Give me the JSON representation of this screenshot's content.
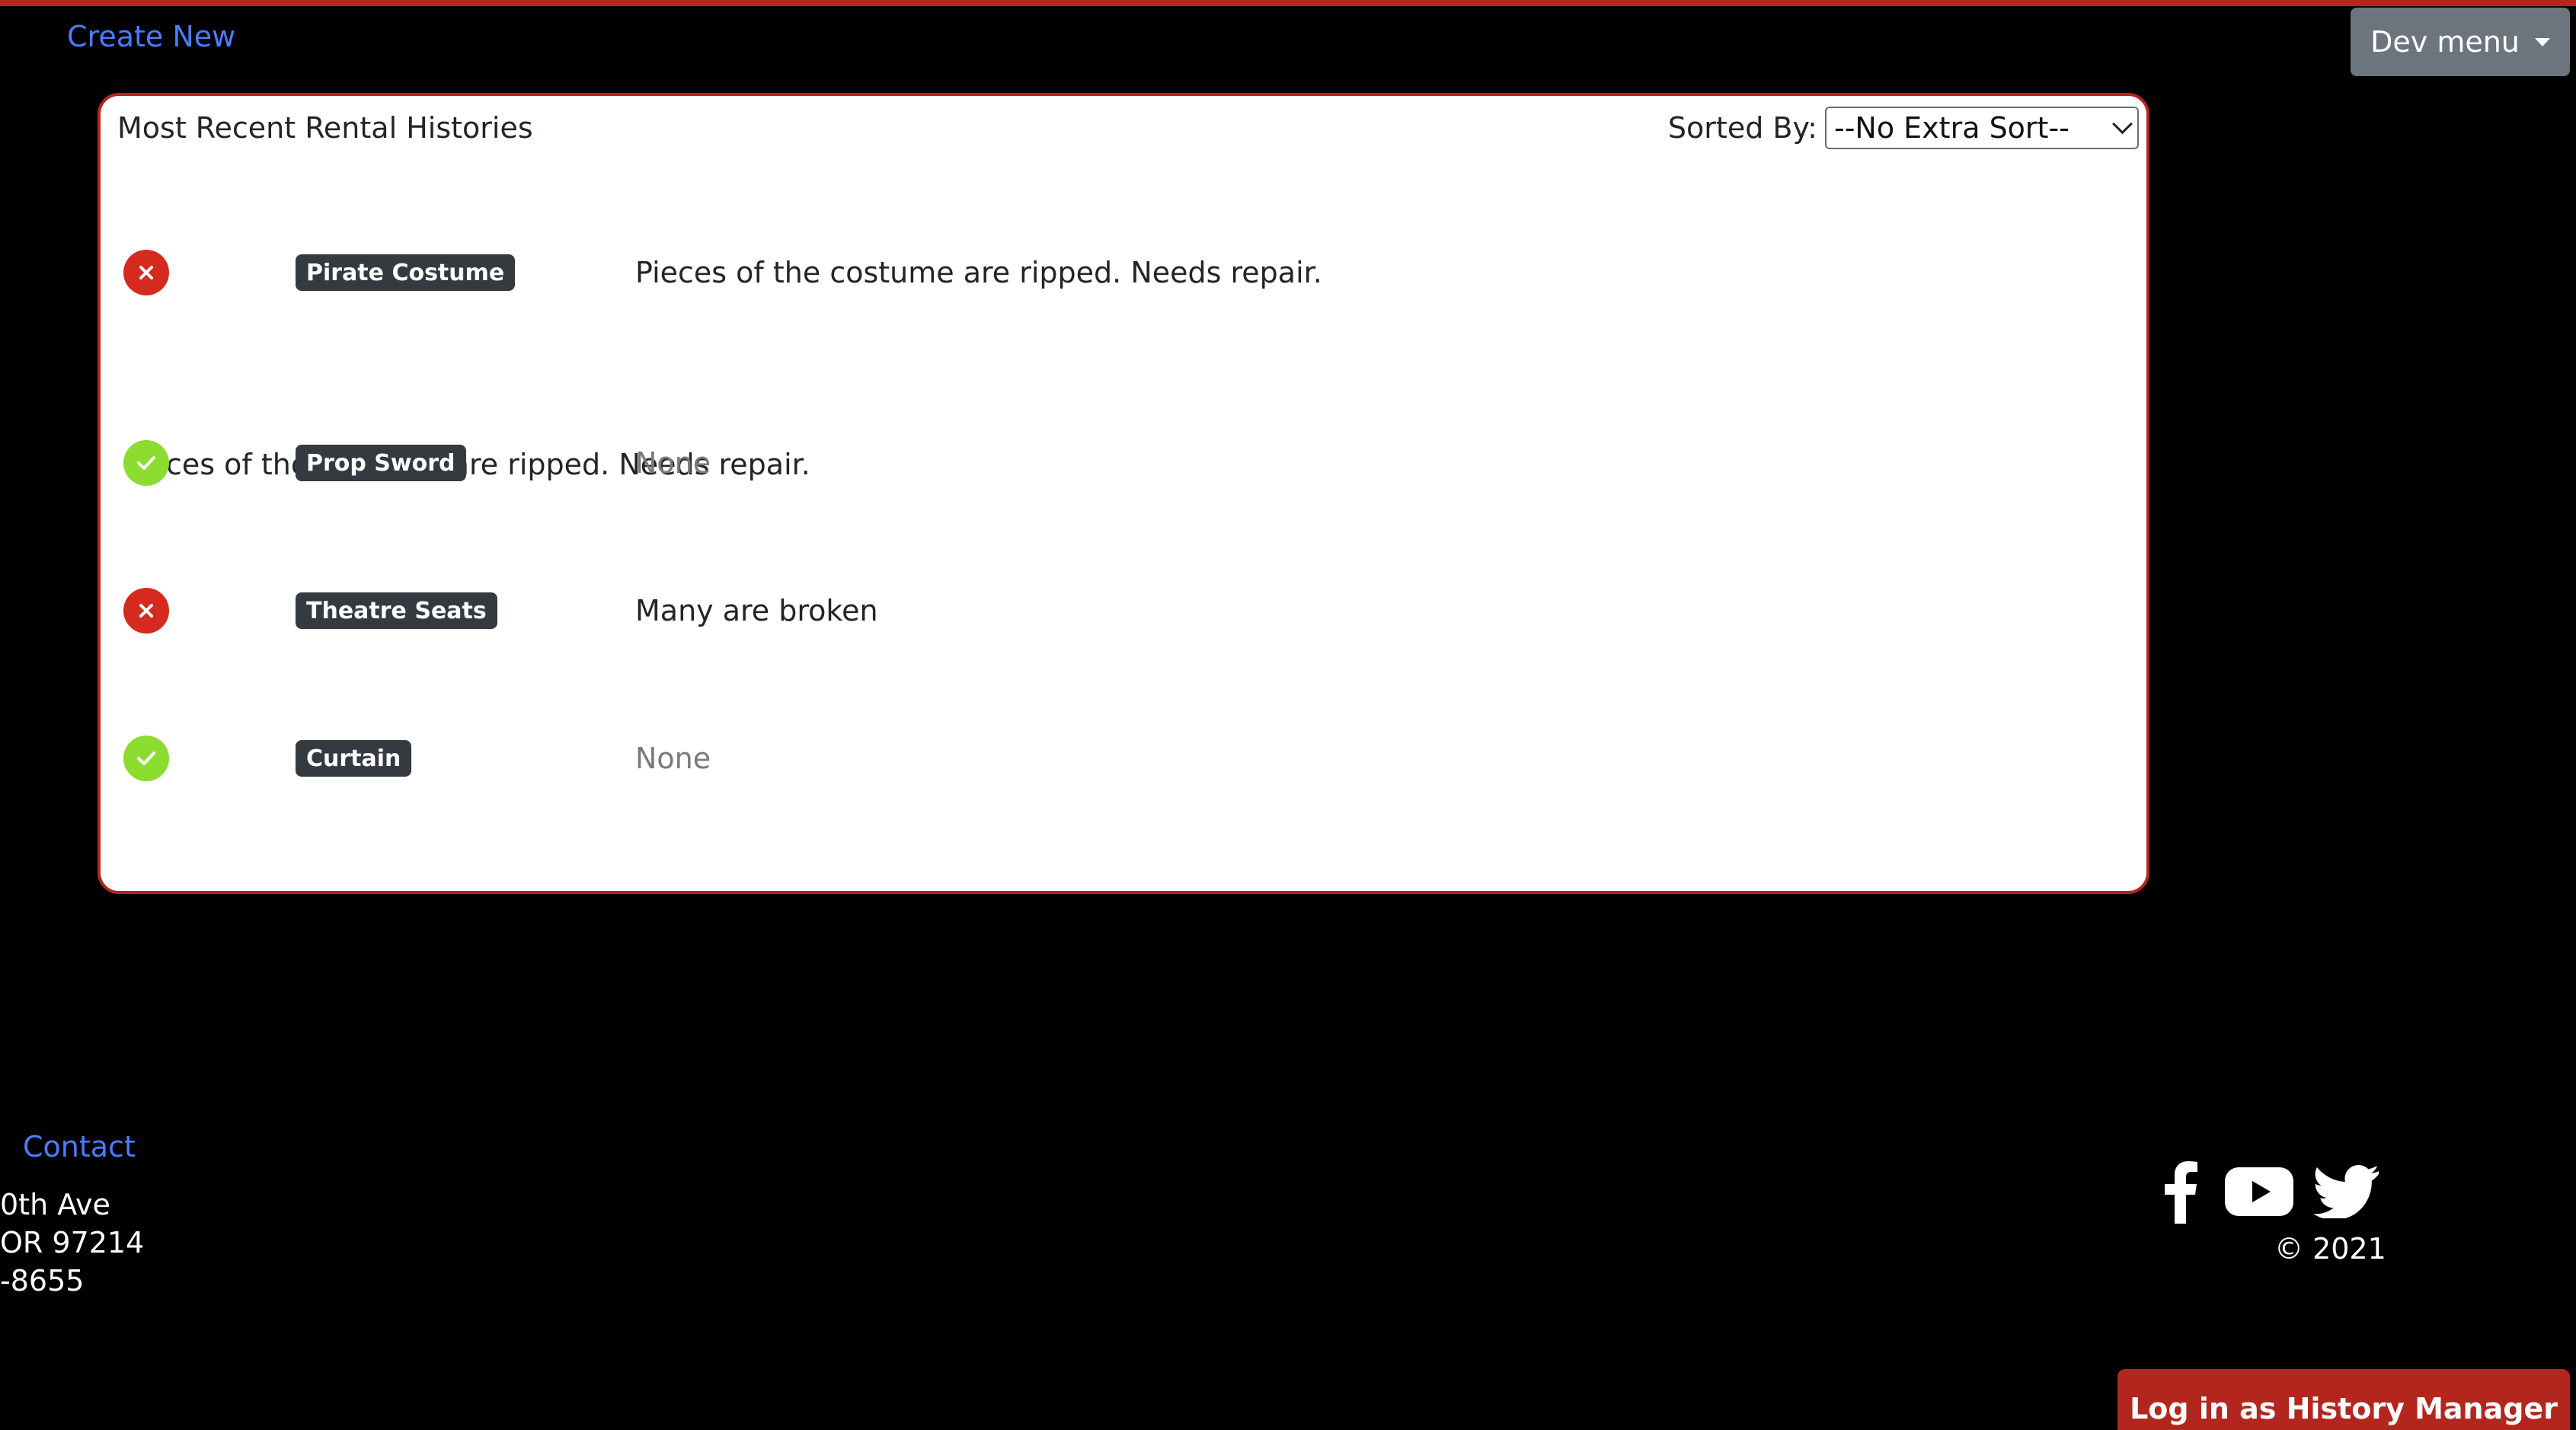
{
  "header": {
    "create_new": "Create New",
    "dev_menu": "Dev menu"
  },
  "panel": {
    "title": "Most Recent Rental Histories",
    "sort_label": "Sorted By:",
    "sort_value": "--No Extra Sort--",
    "rows": [
      {
        "status": "damaged",
        "item": "Pirate Costume",
        "note": "Pieces of the costume are ripped. Needs repair."
      },
      {
        "status": "ok",
        "item": "Prop Sword",
        "note": "None"
      },
      {
        "status": "damaged",
        "item": "Theatre Seats",
        "note": "Many are broken"
      },
      {
        "status": "ok",
        "item": "Curtain",
        "note": "None"
      }
    ],
    "expanded_detail": "Pieces of the costume are ripped. Needs repair."
  },
  "footer": {
    "contact": "Contact",
    "address_line1": "0th Ave",
    "address_line2": "OR 97214",
    "address_line3": "-8655",
    "social_icons": [
      "facebook-icon",
      "youtube-icon",
      "twitter-icon"
    ],
    "copyright": "© 2021",
    "login_button": "Log in as History Manager"
  },
  "colors": {
    "accent_red": "#b3261e",
    "link_blue": "#4a7cff",
    "status_bad": "#d52b1e",
    "status_good": "#8bdc2e",
    "badge_dark": "#343a40",
    "dev_menu_gray": "#6c757d"
  }
}
